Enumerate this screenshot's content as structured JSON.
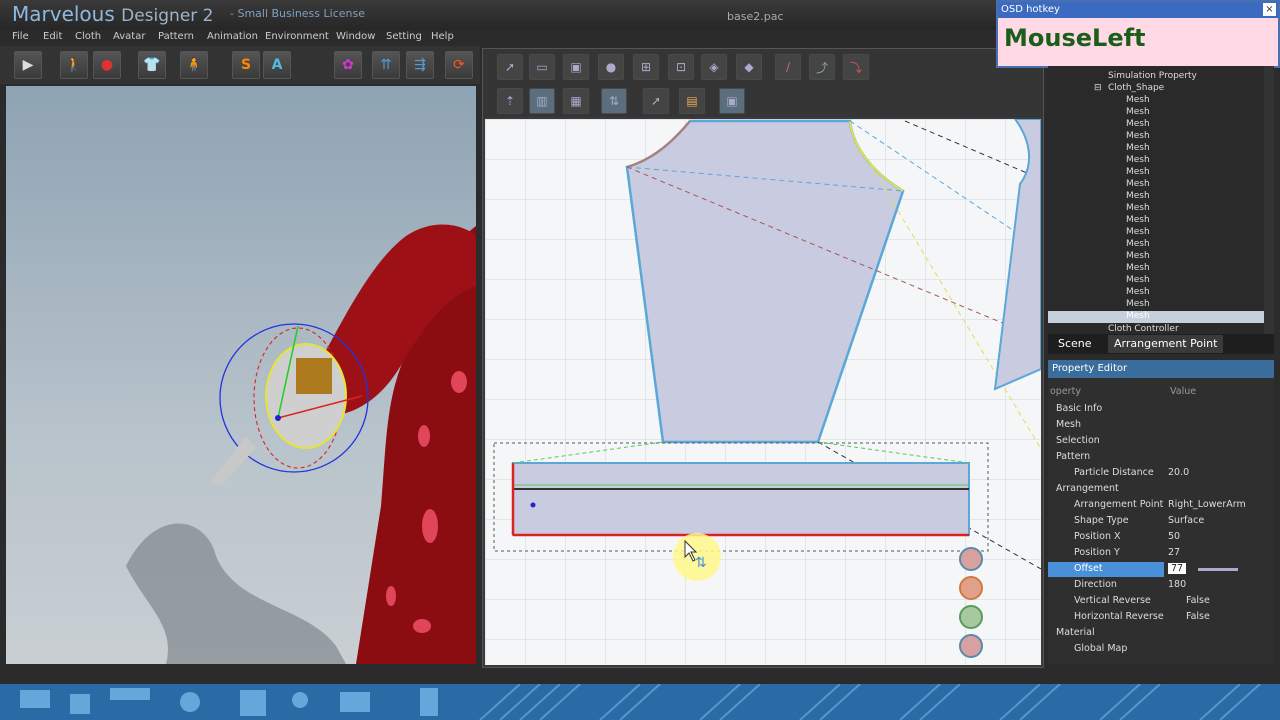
{
  "titlebar": {
    "app_name": "Marvelous",
    "app_name2": "Designer 2",
    "license": "-   Small Business License",
    "filename": "base2.pac"
  },
  "menu": [
    "File",
    "Edit",
    "Cloth",
    "Avatar",
    "Pattern",
    "Animation",
    "Environment",
    "Window",
    "Setting",
    "Help"
  ],
  "toolbar_left": {
    "s_label": "S",
    "a_label": "A"
  },
  "osd": {
    "title": "OSD hotkey",
    "close": "×",
    "key": "MouseLeft"
  },
  "scene_tree": {
    "simulation_property": "Simulation Property",
    "cloth_shape": "Cloth_Shape",
    "mesh_label": "Mesh",
    "cloth_controller": "Cloth Controller"
  },
  "tabs": {
    "scene": "Scene",
    "arrangement_point": "Arrangement Point"
  },
  "property_editor": {
    "title": "Property Editor",
    "col_property": "operty",
    "col_value": "Value",
    "rows": [
      {
        "key": "Basic Info",
        "value": ""
      },
      {
        "key": "Mesh",
        "value": ""
      },
      {
        "key": "Selection",
        "value": ""
      },
      {
        "key": "Pattern",
        "value": ""
      },
      {
        "key": "Particle Distance",
        "value": "20.0"
      },
      {
        "key": "Arrangement",
        "value": ""
      },
      {
        "key": "Arrangement Point",
        "value": "Right_LowerArm"
      },
      {
        "key": "Shape Type",
        "value": "Surface"
      },
      {
        "key": "Position X",
        "value": "50"
      },
      {
        "key": "Position Y",
        "value": "27"
      },
      {
        "key": "Offset",
        "value": "77"
      },
      {
        "key": "Direction",
        "value": "180"
      },
      {
        "key": "Vertical Reverse",
        "value": "False"
      },
      {
        "key": "Horizontal Reverse",
        "value": "False"
      },
      {
        "key": "Material",
        "value": ""
      },
      {
        "key": "Global Map",
        "value": ""
      }
    ]
  },
  "colors": {
    "accent": "#4a90d9",
    "pattern_fill": "#c9cbe0",
    "pattern_edge": "#5aa7d8",
    "dress": "#8b0d12"
  }
}
